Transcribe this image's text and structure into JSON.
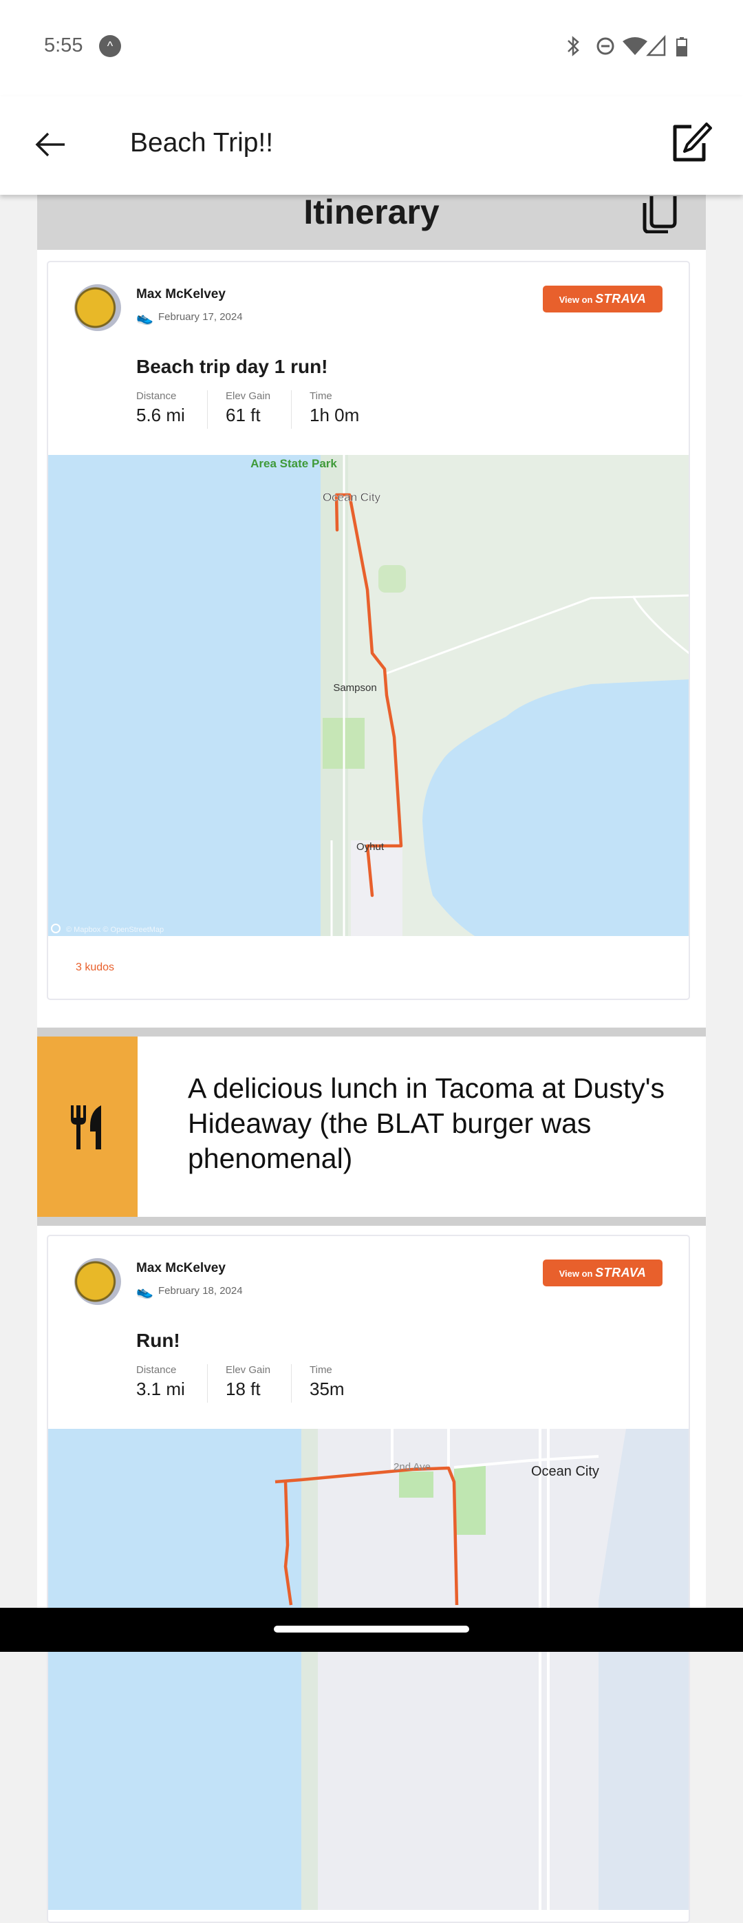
{
  "status_bar": {
    "time": "5:55",
    "icons": [
      "app-notification-icon",
      "bluetooth-icon",
      "do-not-disturb-icon",
      "wifi-icon",
      "signal-icon",
      "battery-icon"
    ]
  },
  "app_bar": {
    "title": "Beach Trip!!",
    "back_icon": "arrow-left-icon",
    "edit_icon": "edit-icon"
  },
  "itinerary": {
    "title": "Itinerary",
    "copy_icon": "copy-icon"
  },
  "items": [
    {
      "type": "strava",
      "athlete": "Max McKelvey",
      "date": "February 17, 2024",
      "button": {
        "prefix": "View on",
        "brand": "STRAVA"
      },
      "title": "Beach trip day 1 run!",
      "stats": [
        {
          "label": "Distance",
          "value": "5.6 mi"
        },
        {
          "label": "Elev Gain",
          "value": "61 ft"
        },
        {
          "label": "Time",
          "value": "1h 0m"
        }
      ],
      "map": {
        "labels": [
          "Area State Park",
          "Ocean City",
          "Sampson",
          "Oyhut"
        ],
        "attribution": "© Mapbox © OpenStreetMap"
      },
      "kudos": "3 kudos"
    },
    {
      "type": "note",
      "icon": "fork-knife-icon",
      "text": "A delicious lunch in Tacoma at Dusty's Hideaway (the BLAT burger was phenomenal)"
    },
    {
      "type": "strava",
      "athlete": "Max McKelvey",
      "date": "February 18, 2024",
      "button": {
        "prefix": "View on",
        "brand": "STRAVA"
      },
      "title": "Run!",
      "stats": [
        {
          "label": "Distance",
          "value": "3.1 mi"
        },
        {
          "label": "Elev Gain",
          "value": "18 ft"
        },
        {
          "label": "Time",
          "value": "35m"
        }
      ],
      "map": {
        "labels": [
          "2nd Ave",
          "Ocean City"
        ]
      }
    }
  ],
  "colors": {
    "strava_orange": "#e8602c",
    "note_accent": "#f0a93c",
    "water": "#c2e2f8",
    "header_gray": "#d3d3d3"
  }
}
